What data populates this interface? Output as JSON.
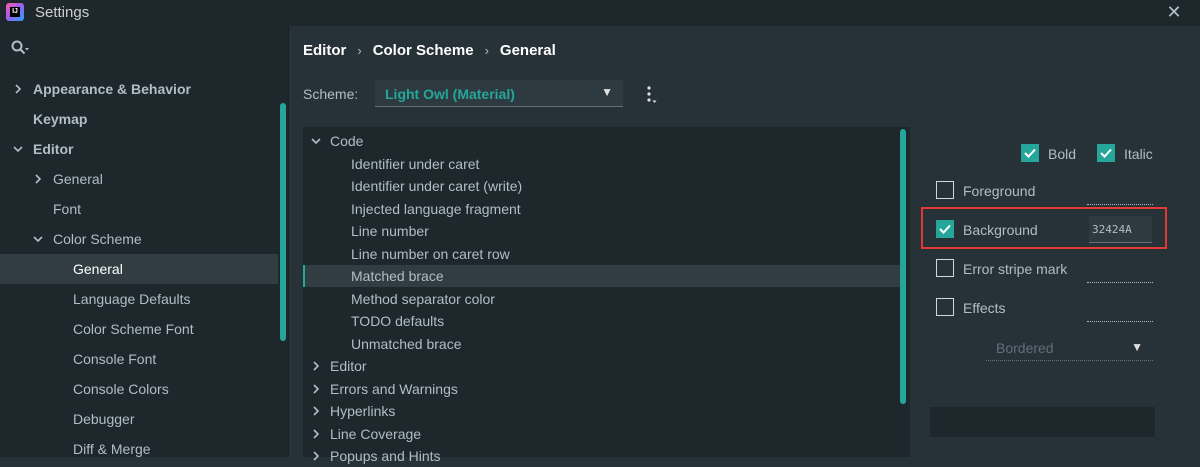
{
  "window": {
    "title": "Settings",
    "app_icon_text": "IJ",
    "close_glyph": "✕"
  },
  "sidebar": {
    "items": [
      {
        "label": "Appearance & Behavior",
        "level": 0,
        "expanded": false,
        "bold": true
      },
      {
        "label": "Keymap",
        "level": 0,
        "bold": true
      },
      {
        "label": "Editor",
        "level": 0,
        "expanded": true,
        "bold": true
      },
      {
        "label": "General",
        "level": 1,
        "expanded": false
      },
      {
        "label": "Font",
        "level": 1
      },
      {
        "label": "Color Scheme",
        "level": 1,
        "expanded": true
      },
      {
        "label": "General",
        "level": 2,
        "selected": true
      },
      {
        "label": "Language Defaults",
        "level": 2
      },
      {
        "label": "Color Scheme Font",
        "level": 2
      },
      {
        "label": "Console Font",
        "level": 2
      },
      {
        "label": "Console Colors",
        "level": 2
      },
      {
        "label": "Debugger",
        "level": 2
      },
      {
        "label": "Diff & Merge",
        "level": 2
      }
    ]
  },
  "breadcrumb": {
    "items": [
      "Editor",
      "Color Scheme",
      "General"
    ],
    "separator": "›"
  },
  "scheme": {
    "label": "Scheme:",
    "value": "Light Owl (Material)",
    "caret": "▼"
  },
  "options": {
    "items": [
      {
        "label": "Code",
        "level": 0,
        "expanded": true
      },
      {
        "label": "Identifier under caret",
        "level": 1
      },
      {
        "label": "Identifier under caret (write)",
        "level": 1
      },
      {
        "label": "Injected language fragment",
        "level": 1
      },
      {
        "label": "Line number",
        "level": 1
      },
      {
        "label": "Line number on caret row",
        "level": 1
      },
      {
        "label": "Matched brace",
        "level": 1,
        "selected": true
      },
      {
        "label": "Method separator color",
        "level": 1
      },
      {
        "label": "TODO defaults",
        "level": 1
      },
      {
        "label": "Unmatched brace",
        "level": 1
      },
      {
        "label": "Editor",
        "level": 0,
        "expanded": false
      },
      {
        "label": "Errors and Warnings",
        "level": 0,
        "expanded": false
      },
      {
        "label": "Hyperlinks",
        "level": 0,
        "expanded": false
      },
      {
        "label": "Line Coverage",
        "level": 0,
        "expanded": false
      },
      {
        "label": "Popups and Hints",
        "level": 0,
        "expanded": false
      }
    ]
  },
  "attributes": {
    "bold": {
      "label": "Bold",
      "checked": true
    },
    "italic": {
      "label": "Italic",
      "checked": true
    },
    "foreground": {
      "label": "Foreground",
      "checked": false,
      "color": ""
    },
    "background": {
      "label": "Background",
      "checked": true,
      "color": "32424A"
    },
    "error_stripe": {
      "label": "Error stripe mark",
      "checked": false,
      "color": ""
    },
    "effects": {
      "label": "Effects",
      "checked": false,
      "color": "",
      "type": "Bordered",
      "caret": "▼"
    }
  },
  "colors": {
    "accent": "#26a69a",
    "background": "#263238",
    "panel": "#1e272c",
    "selection": "#313d43",
    "text": "#b0bec5",
    "highlight_outline": "#e53935"
  }
}
